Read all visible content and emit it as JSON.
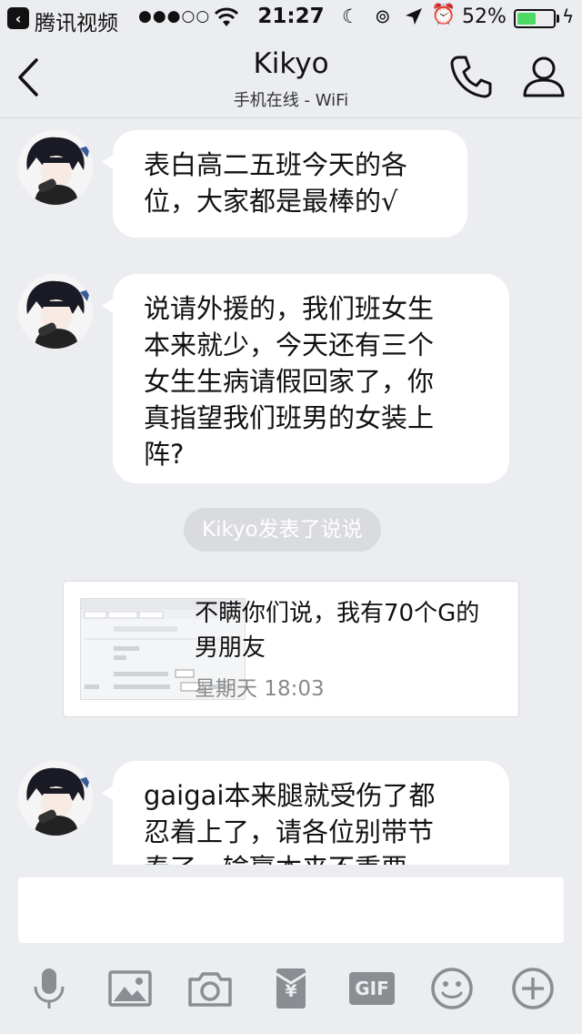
{
  "status_bar": {
    "back_app": "腾讯视频",
    "signal": "●●●○○",
    "time": "21:27",
    "battery": "52%",
    "battery_level": 0.52,
    "icons": [
      "back-icon",
      "wifi-icon",
      "moon-icon",
      "lock-rotation-icon",
      "location-icon",
      "alarm-icon",
      "battery-icon",
      "charging-icon"
    ]
  },
  "nav": {
    "title": "Kikyo",
    "subtitle": "手机在线 - WiFi",
    "icons": [
      "back-chevron-icon",
      "phone-icon",
      "profile-icon"
    ]
  },
  "messages": [
    {
      "lines": [
        "表白高二五班今天的各",
        "位，大家都是最棒的√"
      ]
    },
    {
      "lines": [
        "说请外援的，我们班女生",
        "本来就少，今天还有三个",
        "女生生病请假回家了，你",
        "真指望我们班男的女装上",
        "阵?"
      ]
    },
    {
      "lines": [
        "gaigai本来腿就受伤了都",
        "忍着上了，请各位别带节",
        "奏了，输赢本来不重要"
      ]
    }
  ],
  "system_notice": "Kikyo发表了说说",
  "post_card": {
    "lines": [
      "不瞒你们说，我有70个G的",
      "男朋友"
    ],
    "time": "星期天 18:03"
  },
  "toolbar": {
    "icons": [
      "microphone-icon",
      "image-icon",
      "camera-icon",
      "red-packet-icon",
      "gif-icon",
      "emoji-icon",
      "plus-icon"
    ],
    "gif_label": "GIF",
    "yuan_symbol": "¥"
  },
  "colors": {
    "background": "#ebedf0",
    "bubble": "#ffffff",
    "battery_green": "#4cd964",
    "icon_gray": "#8a8d92"
  }
}
